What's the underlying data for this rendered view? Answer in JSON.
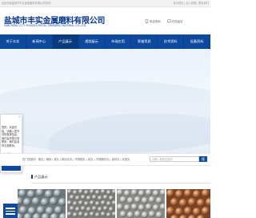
{
  "topbar": {
    "welcome": "欢迎光临盐城市丰实金属磨料有限公司官网！",
    "links": "设为首页 | 加入收藏 | 联系我们"
  },
  "header": {
    "company_name": "盐城市丰实金属磨料有限公司",
    "company_name_en": "YANCHENG CITY FENGSHI METAL GRINDING MATERIAL CO.,LTD.",
    "contact_phone_label": "电话咨询",
    "contact_online_label": "在线留言"
  },
  "nav": {
    "items": [
      {
        "label": "关于丰实"
      },
      {
        "label": "新闻中心"
      },
      {
        "label": "产品展示"
      },
      {
        "label": "视频展示"
      },
      {
        "label": "市场应用"
      },
      {
        "label": "荣誉资质"
      },
      {
        "label": "技术资料"
      },
      {
        "label": "设备资料"
      }
    ]
  },
  "popup": {
    "close": "×",
    "message": "您好，欢迎光临，请输入您不可的需求信息，我们会尽快与您联系，我们会及时与您联系。",
    "sub": "在线客服"
  },
  "search": {
    "hot_words": "热门关键词：钢丸 | 钢砂 | 铁丸 | 钢丝切丸 | 不锈钢丸 | 铝丸 | 不锈钢切丸 | 铝切丸 | 灰铁丸",
    "placeholder": "请输入搜索关键词",
    "button": "搜"
  },
  "products": {
    "title": "产品展示"
  },
  "colors": {
    "brand_blue": "#0d4a9e",
    "dark_blue": "#083a80"
  }
}
